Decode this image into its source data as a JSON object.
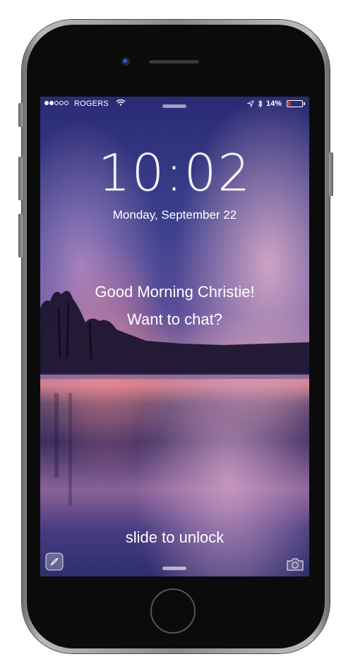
{
  "status_bar": {
    "signal_bars_full": 2,
    "signal_bars_total": 5,
    "carrier": "ROGERS",
    "wifi_icon": "wifi-icon",
    "location_icon": "location-arrow-icon",
    "bluetooth_icon": "bluetooth-icon",
    "battery_percent_label": "14%",
    "battery_level": 0.14,
    "battery_color": "#ff3b30"
  },
  "lock_screen": {
    "time": "10:02",
    "date": "Monday, September 22",
    "greeting": "Good Morning Christie!",
    "prompt": "Want to chat?",
    "unlock_hint": "slide to unlock",
    "left_shortcut_icon": "compass-icon",
    "right_shortcut_icon": "camera-icon"
  },
  "device": {
    "frame_color": "#0b0b0c",
    "bezel_color": "#9a9a9e"
  }
}
